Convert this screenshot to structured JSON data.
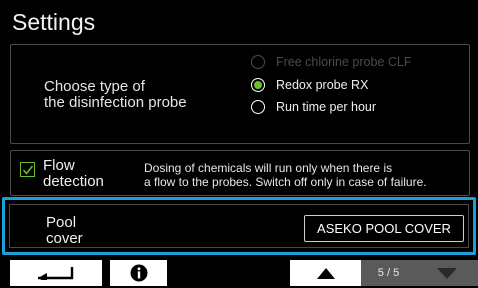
{
  "header": {
    "title": "Settings"
  },
  "disinfection": {
    "label": "Choose type of\nthe disinfection probe",
    "options": [
      {
        "label": "Free chlorine probe CLF",
        "state": "disabled"
      },
      {
        "label": "Redox probe RX",
        "state": "selected"
      },
      {
        "label": "Run time per hour",
        "state": "unselected"
      }
    ]
  },
  "flow": {
    "checked": true,
    "label": "Flow\ndetection",
    "description": "Dosing of chemicals will run only when there is\na flow to the probes. Switch off only in case of failure."
  },
  "pool_cover": {
    "label": "Pool\ncover",
    "value": "ASEKO POOL COVER"
  },
  "toolbar": {
    "page_indicator": "5 / 5"
  },
  "colors": {
    "accent_blue": "#1ba0d7",
    "accent_green": "#6bbf2e",
    "disabled_gray": "#4b4b4b"
  },
  "icons": [
    "back-arrow-icon",
    "info-icon",
    "arrow-up-icon",
    "arrow-down-icon"
  ]
}
